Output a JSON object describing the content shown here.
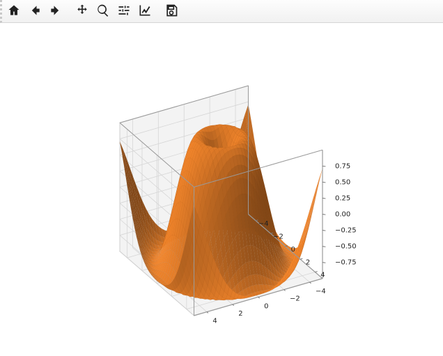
{
  "toolbar": {
    "home": "Home",
    "back": "Back",
    "forward": "Forward",
    "pan": "Pan",
    "zoom": "Zoom",
    "subplots": "Configure subplots",
    "axis_edit": "Edit axis",
    "save": "Save"
  },
  "chart_data": {
    "type": "surface-3d",
    "formula": "z = sin(sqrt(x^2 + y^2))",
    "color": "#e07b28",
    "xlabel": "",
    "ylabel": "",
    "zlabel": "",
    "xlim": [
      -5,
      5
    ],
    "ylim": [
      -5,
      5
    ],
    "zlim": [
      -1,
      1
    ],
    "xticks": [
      -4,
      -2,
      0,
      2,
      4
    ],
    "yticks": [
      -4,
      -2,
      0,
      2,
      4
    ],
    "zticks": [
      -0.75,
      -0.5,
      -0.25,
      0.0,
      0.25,
      0.5,
      0.75
    ],
    "azimuth_deg": -60,
    "elevation_deg": 30,
    "grid": true,
    "x_values": [
      -5,
      -4.5,
      -4,
      -3.5,
      -3,
      -2.5,
      -2,
      -1.5,
      -1,
      -0.5,
      0,
      0.5,
      1,
      1.5,
      2,
      2.5,
      3,
      3.5,
      4,
      4.5,
      5
    ],
    "y_values": [
      -5,
      -4.5,
      -4,
      -3.5,
      -3,
      -2.5,
      -2,
      -1.5,
      -1,
      -0.5,
      0,
      0.5,
      1,
      1.5,
      2,
      2.5,
      3,
      3.5,
      4,
      4.5,
      5
    ]
  }
}
